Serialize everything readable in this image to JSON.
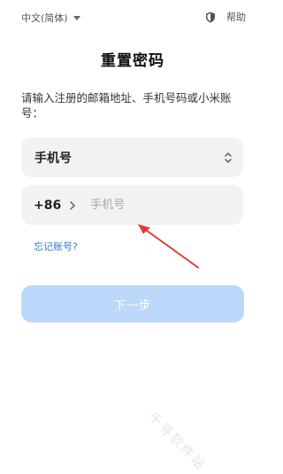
{
  "topbar": {
    "language": "中文(简体)",
    "help": "帮助"
  },
  "title": "重置密码",
  "instructions": "请输入注册的邮箱地址、手机号码或小米账号：",
  "account_type": {
    "selected": "手机号"
  },
  "phone": {
    "country_code": "+86",
    "placeholder": "手机号",
    "value": ""
  },
  "forgot_link": "忘记账号?",
  "next_button": "下一步",
  "watermark": "千寻软件站",
  "colors": {
    "accent": "#2f7cd6",
    "button_disabled": "#bcd8fb",
    "field_bg": "#f2f2f2",
    "annotation_arrow": "#e53935"
  },
  "icons": {
    "language_caret": "chevron-down-icon",
    "help": "shield-icon",
    "select_arrows": "up-down-arrows-icon",
    "country_chevron": "chevron-right-icon"
  }
}
